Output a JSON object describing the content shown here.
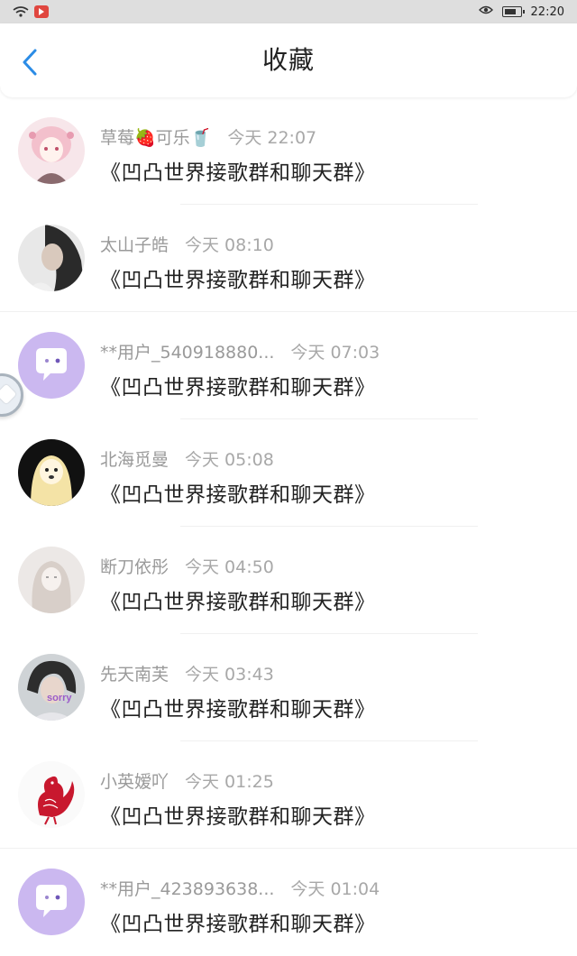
{
  "status_bar": {
    "time": "22:20"
  },
  "header": {
    "title": "收藏"
  },
  "items": [
    {
      "name": "草莓🍓可乐🥤",
      "time": "今天 22:07",
      "message": "《凹凸世界接歌群和聊天群》",
      "avatar": "anime-pink-hair"
    },
    {
      "name": "太山子皓",
      "time": "今天 08:10",
      "message": "《凹凸世界接歌群和聊天群》",
      "avatar": "photo-girl-grey"
    },
    {
      "name": "**用户_540918880...",
      "time": "今天 07:03",
      "message": "《凹凸世界接歌群和聊天群》",
      "avatar": "default-purple-chat"
    },
    {
      "name": "北海觅曼",
      "time": "今天 05:08",
      "message": "《凹凸世界接歌群和聊天群》",
      "avatar": "cartoon-dog-dark"
    },
    {
      "name": "断刀依彤",
      "time": "今天 04:50",
      "message": "《凹凸世界接歌群和聊天群》",
      "avatar": "sketch-girl-light"
    },
    {
      "name": "先天南芙",
      "time": "今天 03:43",
      "message": "《凹凸世界接歌群和聊天群》",
      "avatar": "photo-girl-sorry"
    },
    {
      "name": "小英嫒吖",
      "time": "今天 01:25",
      "message": "《凹凸世界接歌群和聊天群》",
      "avatar": "red-rooster-papercut"
    },
    {
      "name": "**用户_423893638...",
      "time": "今天 01:04",
      "message": "《凹凸世界接歌群和聊天群》",
      "avatar": "default-purple-chat"
    }
  ],
  "colors": {
    "accent_blue": "#2b8ce6",
    "default_avatar_purple": "#cbb8f0",
    "name_gray": "#9a9a9a",
    "message_text": "#222222"
  }
}
